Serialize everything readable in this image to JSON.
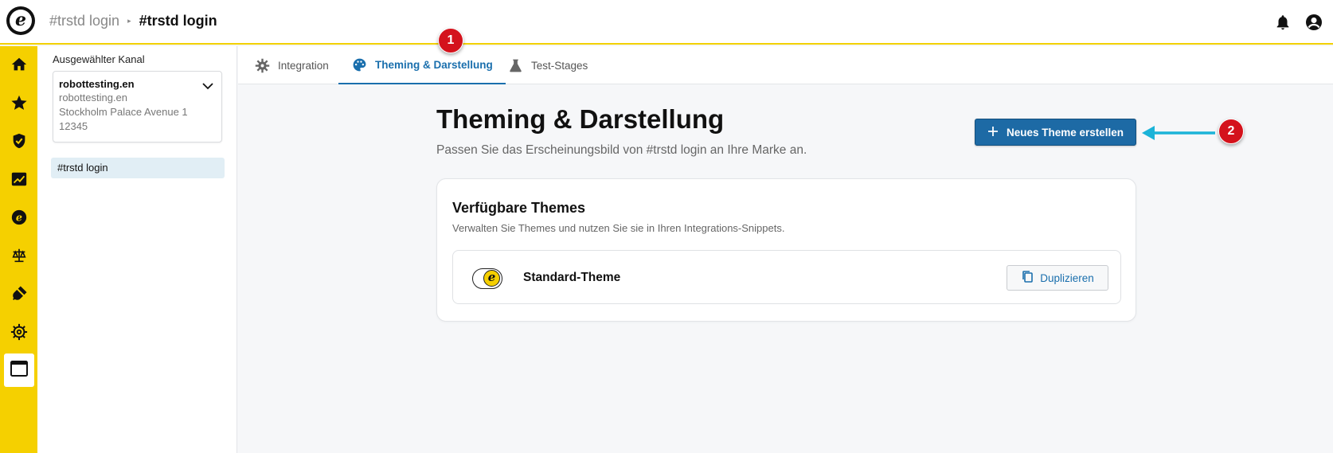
{
  "header": {
    "breadcrumb": [
      "#trstd login",
      "#trstd login"
    ],
    "logo_letter": "e"
  },
  "rail": {
    "items": [
      {
        "icon": "home-icon"
      },
      {
        "icon": "star-icon"
      },
      {
        "icon": "shield-icon"
      },
      {
        "icon": "chart-icon"
      },
      {
        "icon": "brand-e-icon"
      },
      {
        "icon": "scales-icon"
      },
      {
        "icon": "plug-icon"
      },
      {
        "icon": "gear-icon"
      },
      {
        "icon": "browser-window-icon",
        "active": true
      }
    ],
    "accent": "#f5d000"
  },
  "sidebar": {
    "label": "Ausgewählter Kanal",
    "channel": {
      "name": "robottesting.en",
      "lines": [
        "robottesting.en",
        "Stockholm Palace Avenue 1",
        "12345"
      ]
    },
    "selected_item": "#trstd login"
  },
  "tabs": [
    {
      "label": "Integration",
      "icon": "gear-icon",
      "active": false
    },
    {
      "label": "Theming & Darstellung",
      "icon": "palette-icon",
      "active": true
    },
    {
      "label": "Test-Stages",
      "icon": "flask-icon",
      "active": false
    }
  ],
  "main": {
    "title": "Theming & Darstellung",
    "subtitle": "Passen Sie das Erscheinungsbild von #trstd login an Ihre Marke an.",
    "new_theme_button": "Neues Theme erstellen",
    "card": {
      "title": "Verfügbare Themes",
      "subtitle": "Verwalten Sie Themes und nutzen Sie sie in Ihren Integrations-Snippets.",
      "themes": [
        {
          "name": "Standard-Theme",
          "action": "Duplizieren",
          "badge_letter": "e"
        }
      ]
    }
  },
  "annotations": {
    "step1": "1",
    "step2": "2",
    "badge_color": "#d4121c",
    "arrow_color": "#1bb3d8"
  },
  "colors": {
    "primary": "#1d6aa5",
    "link": "#1a6fad",
    "header_border": "#f2d100"
  }
}
